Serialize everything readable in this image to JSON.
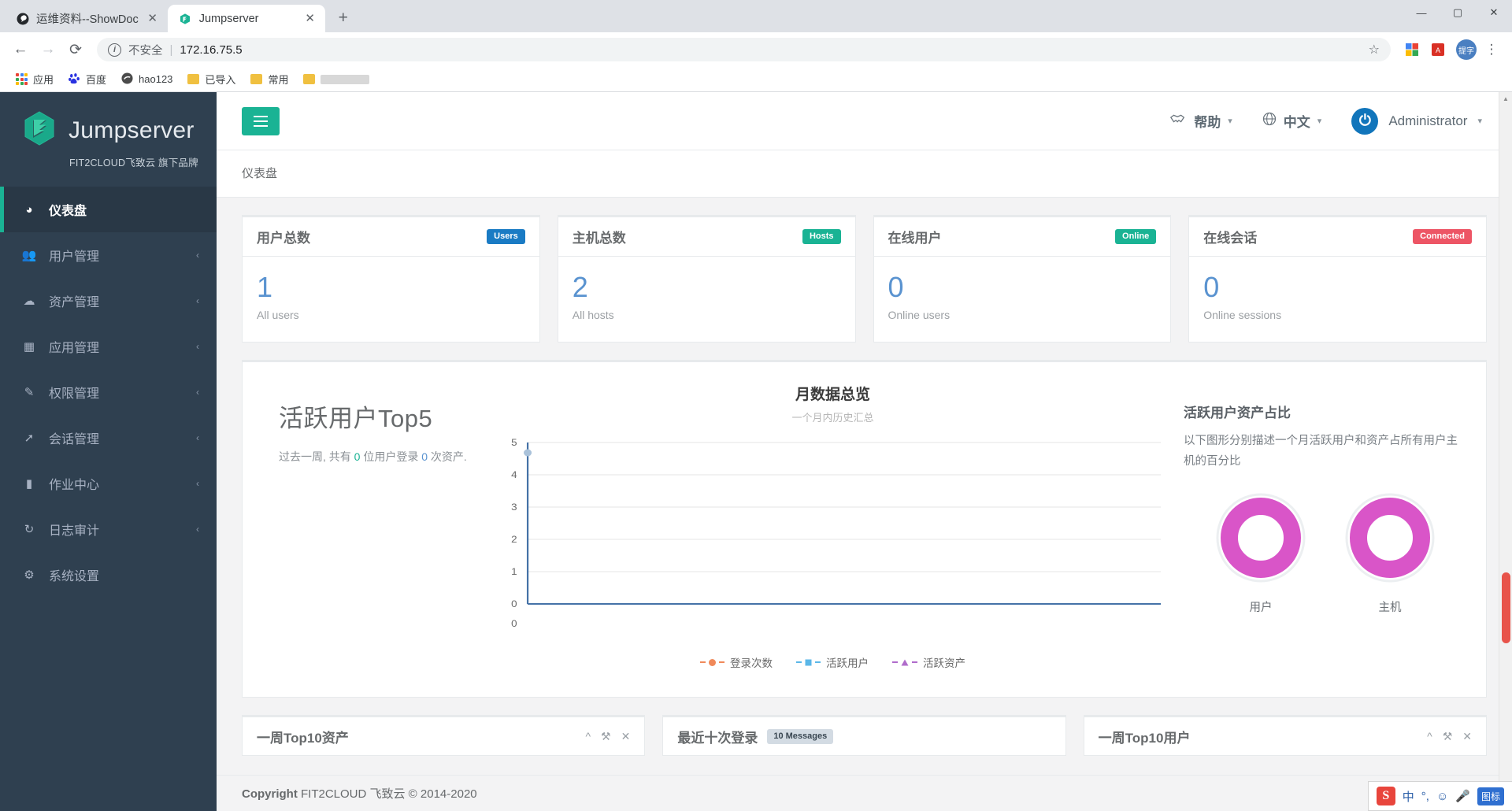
{
  "browser": {
    "tabs": [
      {
        "title": "运维资料--ShowDoc",
        "favicon": "showdoc-icon",
        "active": false,
        "close": "✕"
      },
      {
        "title": "Jumpserver",
        "favicon": "jumpserver-icon",
        "active": true,
        "close": "✕"
      }
    ],
    "new_tab_label": "+",
    "window_controls": {
      "minimize": "—",
      "maximize": "▢",
      "close": "✕"
    },
    "nav": {
      "back": "←",
      "forward": "→",
      "reload": "⟳"
    },
    "omnibox": {
      "info_icon": "i",
      "security_text": "不安全",
      "separator": "|",
      "url": "172.16.75.5",
      "star_icon": "☆"
    },
    "toolbar_icons": [
      "extension-icon",
      "pdf-icon"
    ],
    "profile_badge": "提字",
    "menu_icon": "⋮",
    "bookmarks": [
      {
        "label": "应用",
        "icon": "apps-grid-icon"
      },
      {
        "label": "百度",
        "icon": "baidu-icon"
      },
      {
        "label": "hao123",
        "icon": "hao123-icon"
      },
      {
        "label": "已导入",
        "icon": "folder-icon"
      },
      {
        "label": "常用",
        "icon": "folder-icon"
      },
      {
        "label": "",
        "icon": "folder-icon",
        "redacted": true
      }
    ]
  },
  "sidebar": {
    "brand": {
      "name": "Jumpserver",
      "sub": "FIT2CLOUD飞致云 旗下品牌",
      "logo": "jumpserver-logo"
    },
    "items": [
      {
        "label": "仪表盘",
        "icon": "dashboard-icon",
        "active": true,
        "caret": ""
      },
      {
        "label": "用户管理",
        "icon": "users-icon",
        "active": false,
        "caret": "‹"
      },
      {
        "label": "资产管理",
        "icon": "assets-icon",
        "active": false,
        "caret": "‹"
      },
      {
        "label": "应用管理",
        "icon": "apps-icon",
        "active": false,
        "caret": "‹"
      },
      {
        "label": "权限管理",
        "icon": "perms-icon",
        "active": false,
        "caret": "‹"
      },
      {
        "label": "会话管理",
        "icon": "rocket-icon",
        "active": false,
        "caret": "‹"
      },
      {
        "label": "作业中心",
        "icon": "terminal-icon",
        "active": false,
        "caret": "‹"
      },
      {
        "label": "日志审计",
        "icon": "history-icon",
        "active": false,
        "caret": "‹"
      },
      {
        "label": "系统设置",
        "icon": "gear-icon",
        "active": false,
        "caret": ""
      }
    ]
  },
  "topbar": {
    "hamburger": "menu-icon",
    "help": {
      "label": "帮助",
      "icon": "handshake-icon",
      "caret": "▾"
    },
    "language": {
      "label": "中文",
      "icon": "globe-icon",
      "caret": "▾"
    },
    "user": {
      "name": "Administrator",
      "icon": "power-icon",
      "caret": "▾"
    }
  },
  "breadcrumb": "仪表盘",
  "stat_cards": [
    {
      "title": "用户总数",
      "badge": "Users",
      "badge_color": "#1a7bc4",
      "value": "1",
      "label": "All users"
    },
    {
      "title": "主机总数",
      "badge": "Hosts",
      "badge_color": "#1ab394",
      "value": "2",
      "label": "All hosts"
    },
    {
      "title": "在线用户",
      "badge": "Online",
      "badge_color": "#1ab394",
      "value": "0",
      "label": "Online users"
    },
    {
      "title": "在线会话",
      "badge": "Connected",
      "badge_color": "#ed5565",
      "value": "0",
      "label": "Online sessions"
    }
  ],
  "top5": {
    "heading": "活跃用户Top5",
    "desc_prefix": "过去一周, 共有 ",
    "desc_users": "0",
    "desc_mid": " 位用户登录 ",
    "desc_count": "0",
    "desc_suffix": " 次资产."
  },
  "chart_panel": {
    "title": "月数据总览",
    "subtitle": "一个月内历史汇总"
  },
  "donut_panel": {
    "heading": "活跃用户资产占比",
    "desc": "以下图形分别描述一个月活跃用户和资产占所有用户主机的百分比",
    "donuts": [
      {
        "label": "用户",
        "percent": 100,
        "color": "#d955c8"
      },
      {
        "label": "主机",
        "percent": 100,
        "color": "#d955c8"
      }
    ]
  },
  "bottom_panels": [
    {
      "title": "一周Top10资产",
      "badge": "",
      "tools": [
        "^",
        "⚒",
        "✕"
      ]
    },
    {
      "title": "最近十次登录",
      "badge": "10 Messages",
      "tools": []
    },
    {
      "title": "一周Top10用户",
      "badge": "",
      "tools": [
        "^",
        "⚒",
        "✕"
      ]
    }
  ],
  "footer": {
    "copyright_strong": "Copyright",
    "copyright_text": " FIT2CLOUD 飞致云 © 2014-2020"
  },
  "tray": {
    "logo": "S",
    "items": [
      "中",
      "°,",
      "☺",
      "🎤",
      "图标"
    ]
  },
  "chart_data": {
    "type": "line",
    "title": "月数据总览",
    "subtitle": "一个月内历史汇总",
    "xlabel": "",
    "ylabel": "",
    "ylim": [
      0,
      5
    ],
    "yticks": [
      0,
      1,
      2,
      3,
      4,
      5
    ],
    "x_origin_label": "0",
    "grid": true,
    "legend_position": "bottom",
    "categories": [],
    "series": [
      {
        "name": "登录次数",
        "color": "#f0895a",
        "marker": "circle",
        "values": []
      },
      {
        "name": "活跃用户",
        "color": "#5bb7e8",
        "marker": "square",
        "values": []
      },
      {
        "name": "活跃资产",
        "color": "#b06ccb",
        "marker": "triangle",
        "values": []
      }
    ]
  }
}
